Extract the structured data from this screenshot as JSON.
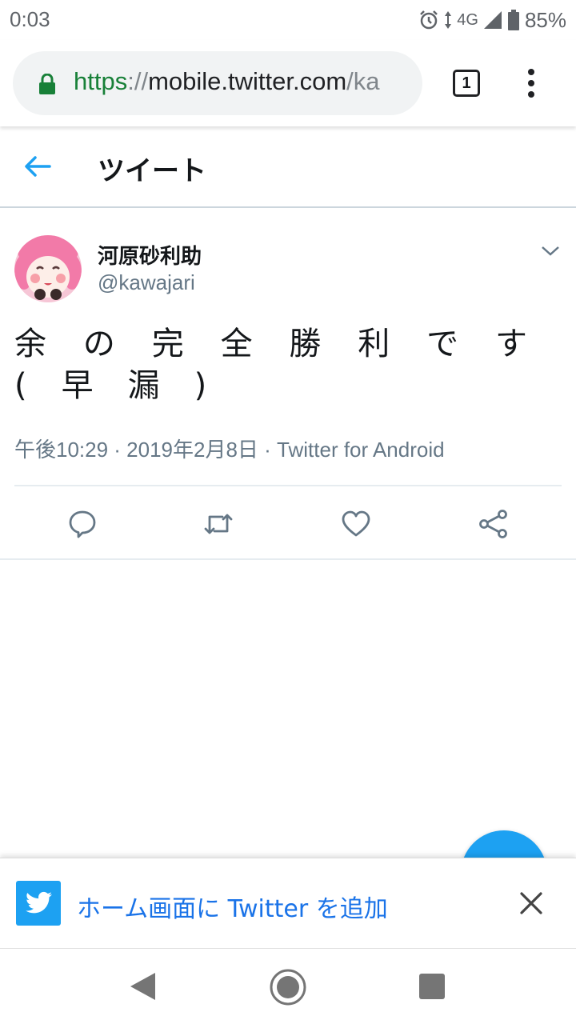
{
  "status_bar": {
    "time": "0:03",
    "network": "4G",
    "battery": "85%",
    "icons": [
      "alarm-icon",
      "data-arrows-icon",
      "signal-icon",
      "battery-icon"
    ]
  },
  "browser": {
    "url_scheme": "https",
    "url_sep": "://",
    "url_host": "mobile.twitter.com",
    "url_path": "/ka",
    "tab_count": "1"
  },
  "header": {
    "title": "ツイート"
  },
  "tweet": {
    "display_name": "河原砂利助",
    "handle": "@kawajari",
    "text": "余の完全勝利です(早漏)",
    "meta": "午後10:29 · 2019年2月8日 · Twitter for Android"
  },
  "actions": [
    "reply-icon",
    "retweet-icon",
    "like-icon",
    "share-icon"
  ],
  "banner": {
    "text": "ホーム画面に Twitter を追加"
  },
  "colors": {
    "accent": "#1da1f2",
    "link": "#1a73e8",
    "secondary_text": "#657786",
    "secure_green": "#188038"
  }
}
